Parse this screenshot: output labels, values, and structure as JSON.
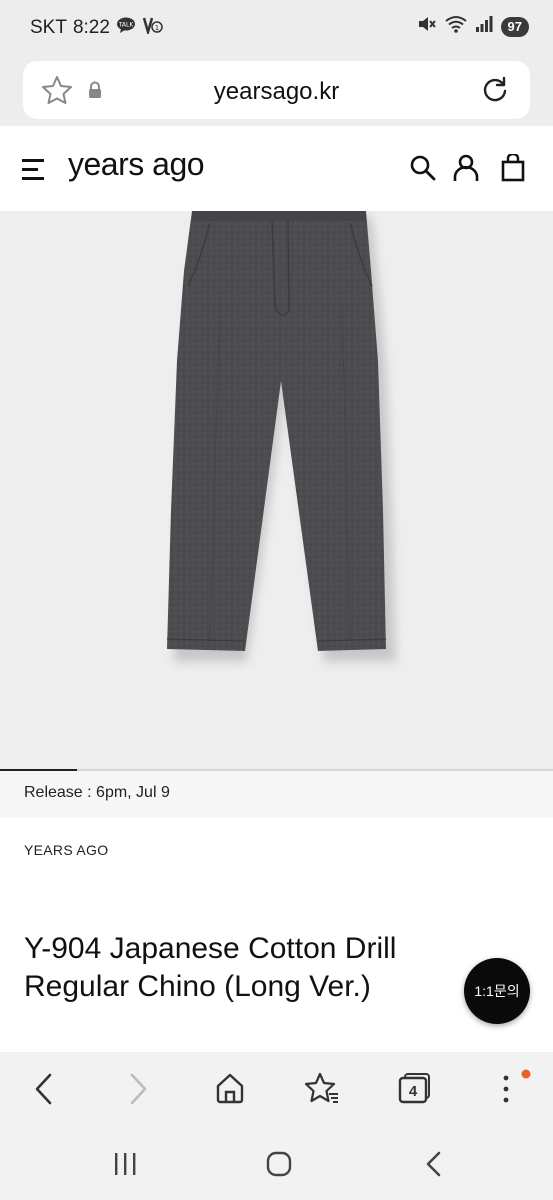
{
  "status_bar": {
    "carrier": "SKT",
    "time": "8:22",
    "battery": "97"
  },
  "browser": {
    "url": "yearsago.kr",
    "tab_count": "4"
  },
  "site": {
    "logo": "years ago"
  },
  "gallery": {
    "progress_fraction": 0.14
  },
  "product": {
    "release": "Release : 6pm, Jul 9",
    "brand": "YEARS AGO",
    "title": "Y-904 Japanese Cotton Drill Regular Chino (Long Ver.)",
    "inquiry_button": "1:1문의"
  },
  "colors": {
    "hero_bg": "#eeeeee",
    "pants": "#4a4b4d",
    "notification_dot": "#e8612c"
  }
}
